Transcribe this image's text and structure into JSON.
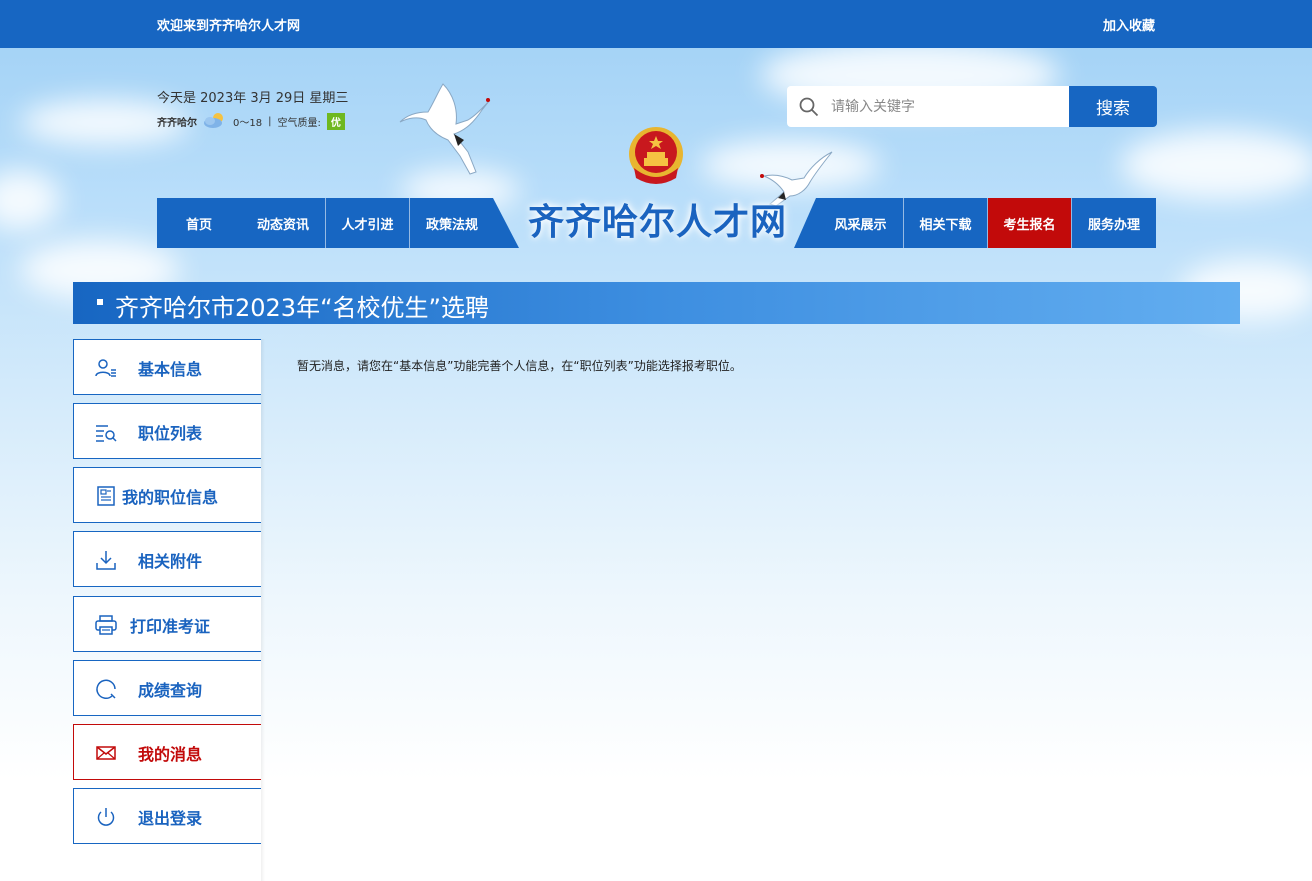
{
  "topbar": {
    "welcome": "欢迎来到齐齐哈尔人才网",
    "favorite": "加入收藏"
  },
  "header": {
    "date": "今天是 2023年 3月 29日 星期三",
    "weather": {
      "city": "齐齐哈尔",
      "temp": "0～18",
      "aq_label": "空气质量:",
      "aq_value": "优",
      "icon": "partly-cloudy-icon"
    },
    "search": {
      "placeholder": "请输入关键字",
      "value": "",
      "button": "搜索"
    },
    "site_title": "齐齐哈尔人才网"
  },
  "nav": {
    "left": [
      "首页",
      "动态资讯",
      "人才引进",
      "政策法规"
    ],
    "right": [
      "风采展示",
      "相关下载",
      "考生报名",
      "服务办理"
    ],
    "active": "考生报名"
  },
  "banner": {
    "title": "齐齐哈尔市2023年“名校优生”选聘"
  },
  "sidebar": {
    "items": [
      {
        "label": "基本信息",
        "icon": "user-info-icon"
      },
      {
        "label": "职位列表",
        "icon": "list-search-icon"
      },
      {
        "label": "我的职位信息",
        "icon": "document-icon"
      },
      {
        "label": "相关附件",
        "icon": "download-icon"
      },
      {
        "label": "打印准考证",
        "icon": "printer-icon"
      },
      {
        "label": "成绩查询",
        "icon": "query-icon"
      },
      {
        "label": "我的消息",
        "icon": "mail-icon"
      },
      {
        "label": "退出登录",
        "icon": "power-icon"
      }
    ],
    "active": "我的消息"
  },
  "content": {
    "message": "暂无消息，请您在“基本信息”功能完善个人信息，在“职位列表”功能选择报考职位。"
  },
  "colors": {
    "primary": "#1766c2",
    "active_red": "#c20a0a",
    "aq_green": "#6fb820"
  }
}
